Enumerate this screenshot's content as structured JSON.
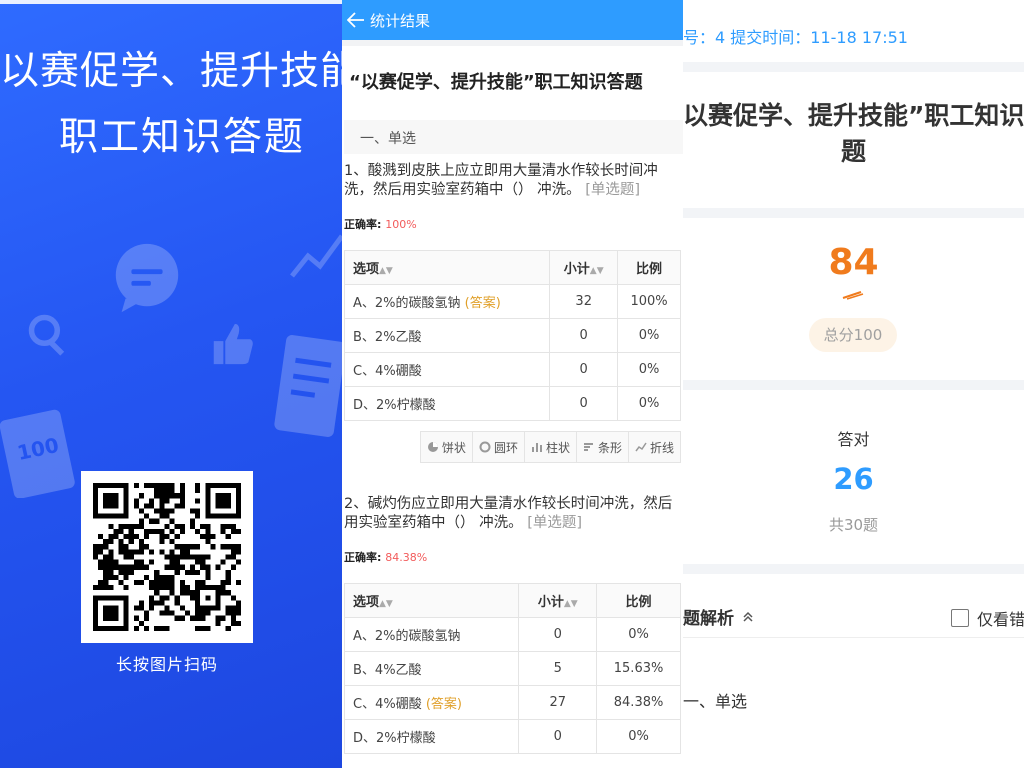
{
  "poster": {
    "title_line1": "以赛促学、提升技能",
    "title_line2": "职工知识答题",
    "qr_caption": "长按图片扫码"
  },
  "stats": {
    "header_title": "统计结果",
    "survey_title": "“以赛促学、提升技能”职工知识答题",
    "section_label": "一、单选",
    "columns": {
      "option": "选项",
      "count": "小计",
      "ratio": "比例"
    },
    "answer_tag": "(答案)",
    "rate_label": "正确率:",
    "chart_types": [
      "饼状",
      "圆环",
      "柱状",
      "条形",
      "折线"
    ],
    "questions": [
      {
        "text": "1、酸溅到皮肤上应立即用大量清水作较长时间冲洗，然后用实验室药箱中（） 冲洗。",
        "type": "[单选题]",
        "rate": "100%",
        "options": [
          {
            "label": "A、2%的碳酸氢钠",
            "is_answer": true,
            "count": "32",
            "ratio": "100%"
          },
          {
            "label": "B、2%乙酸",
            "is_answer": false,
            "count": "0",
            "ratio": "0%"
          },
          {
            "label": "C、4%硼酸",
            "is_answer": false,
            "count": "0",
            "ratio": "0%"
          },
          {
            "label": "D、2%柠檬酸",
            "is_answer": false,
            "count": "0",
            "ratio": "0%"
          }
        ]
      },
      {
        "text": "2、碱灼伤应立即用大量清水作较长时间冲洗，然后用实验室药箱中（） 冲洗。",
        "type": "[单选题]",
        "rate": "84.38%",
        "options": [
          {
            "label": "A、2%的碳酸氢钠",
            "is_answer": false,
            "count": "0",
            "ratio": "0%"
          },
          {
            "label": "B、4%乙酸",
            "is_answer": false,
            "count": "5",
            "ratio": "15.63%"
          },
          {
            "label": "C、4%硼酸",
            "is_answer": true,
            "count": "27",
            "ratio": "84.38%"
          },
          {
            "label": "D、2%柠檬酸",
            "is_answer": false,
            "count": "0",
            "ratio": "0%"
          }
        ]
      }
    ]
  },
  "score": {
    "meta": "号：4  提交时间：11-18 17:51",
    "title_line1": "以赛促学、提升技能”职工知识答",
    "title_line2": "题",
    "score_value": "84",
    "total_label": "总分100",
    "correct_label": "答对",
    "correct_value": "26",
    "total_questions": "共30题",
    "analysis_label": "题解析",
    "only_wrong_label": "仅看错",
    "section_label": "一、单选"
  },
  "colors": {
    "poster_blue": "#2556f2",
    "header_blue": "#2e9cff",
    "answer_gold": "#e0a02a",
    "rate_red": "#f25b5b",
    "score_orange": "#f07b1d"
  }
}
